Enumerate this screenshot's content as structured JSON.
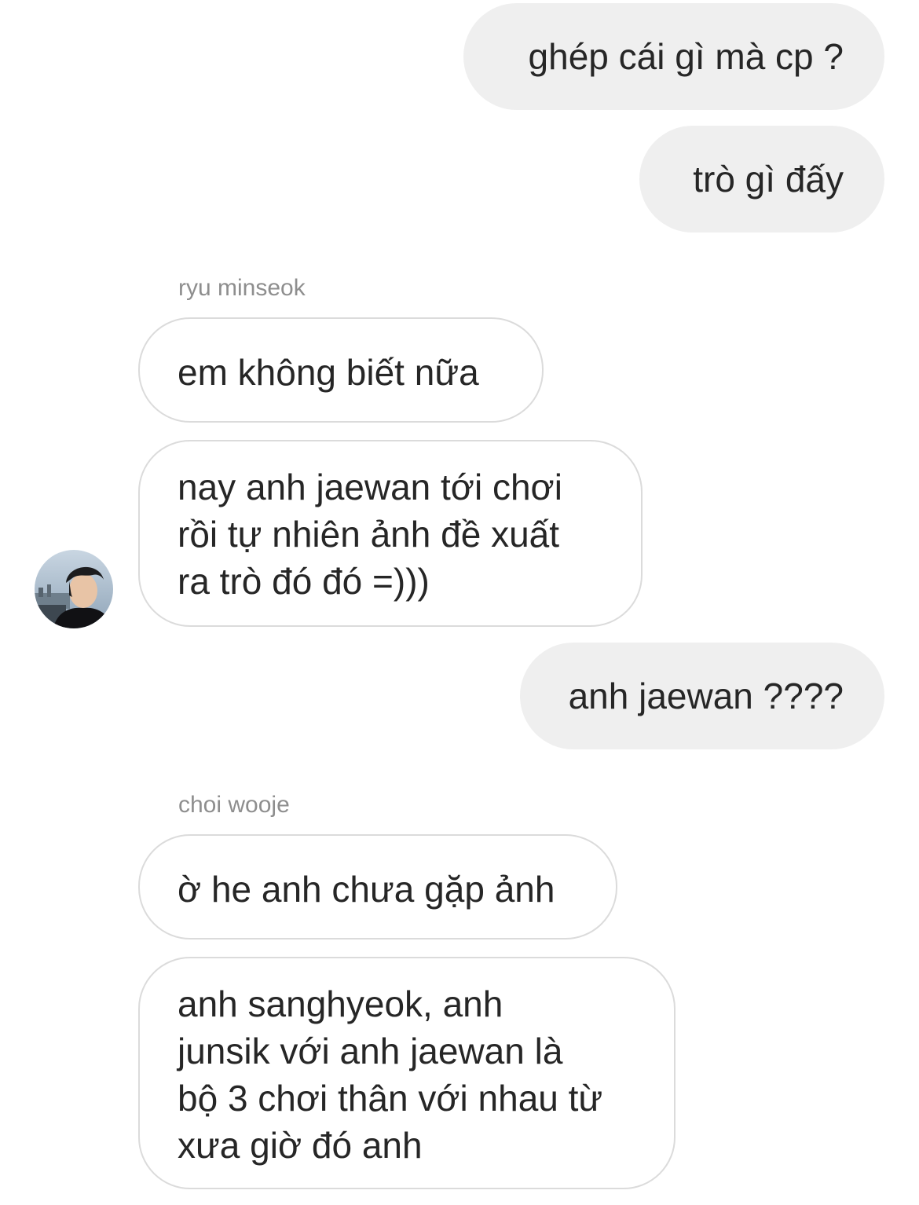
{
  "messages": [
    {
      "from": "me",
      "lines": [
        "ghép cái gì mà cp ?"
      ]
    },
    {
      "from": "me",
      "lines": [
        "trò gì đấy"
      ]
    },
    {
      "sender_label": "ryu minseok"
    },
    {
      "from": "other",
      "lines": [
        "em không biết nữa"
      ]
    },
    {
      "from": "other",
      "lines": [
        "nay anh jaewan tới chơi",
        "rồi tự nhiên ảnh đề xuất",
        "ra trò đó đó =)))"
      ]
    },
    {
      "from": "me",
      "lines": [
        "anh jaewan ????"
      ]
    },
    {
      "sender_label": "choi wooje"
    },
    {
      "from": "other",
      "lines": [
        "ờ he anh chưa gặp ảnh"
      ]
    },
    {
      "from": "other",
      "lines": [
        "anh sanghyeok, anh",
        "junsik với anh jaewan là",
        "bộ 3 chơi thân với nhau từ",
        "xưa giờ đó anh"
      ]
    }
  ],
  "colors": {
    "outgoing_bubble": "#efefef",
    "incoming_border": "#dbdbdb",
    "sender_label": "#8e8e8e",
    "text": "#262626"
  }
}
